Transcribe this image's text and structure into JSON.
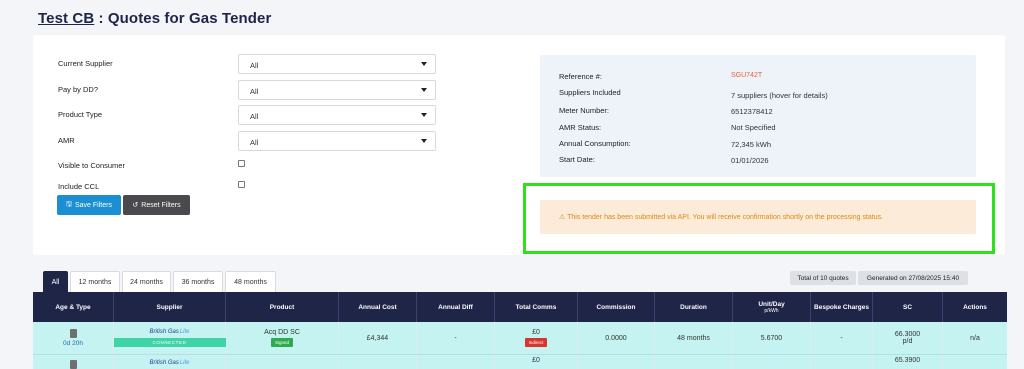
{
  "header": {
    "customer": "Test CB",
    "separator": " : Quotes for ",
    "fuel": "Gas",
    "suffix": " Tender"
  },
  "filters": {
    "current_supplier": {
      "label": "Current Supplier",
      "value": "All"
    },
    "pay_by_dd": {
      "label": "Pay by DD?",
      "value": "All"
    },
    "product_type": {
      "label": "Product Type",
      "value": "All"
    },
    "amr": {
      "label": "AMR",
      "value": "All"
    },
    "visible_to_consumer": {
      "label": "Visible to Consumer"
    },
    "include_ccl": {
      "label": "Include CCL"
    },
    "save_label": "Save Filters",
    "reset_label": "Reset Filters"
  },
  "info": {
    "reference_label": "Reference #:",
    "reference_value": "SGU742T",
    "suppliers_label": "Suppliers Included",
    "suppliers_value": "7 suppliers (hover for details)",
    "meter_label": "Meter Number:",
    "meter_value": "6512378412",
    "amr_label": "AMR Status:",
    "amr_value": "Not Specified",
    "consumption_label": "Annual Consumption:",
    "consumption_value": "72,345 kWh",
    "start_label": "Start Date:",
    "start_value": "01/01/2026"
  },
  "alert": {
    "text": "This tender has been submitted via API. You will receive confirmation shortly on the processing status."
  },
  "tabs": [
    "All",
    "12 months",
    "24 months",
    "36 months",
    "48 months"
  ],
  "summary": {
    "total": "Total of 10 quotes",
    "generated": "Generated on 27/08/2025 15:40"
  },
  "table": {
    "headers": [
      "Age & Type",
      "Supplier",
      "Product",
      "Annual Cost",
      "Annual Diff",
      "Total Comms",
      "Commission",
      "Duration",
      "Unit/Day",
      "Bespoke Charges",
      "SC",
      "Actions"
    ],
    "unit_sub": "p/kWh",
    "rows": [
      {
        "age": "0d 20h",
        "supplier_main": "British Gas",
        "supplier_lite": "Lite",
        "status": "CONNECTED",
        "product": "Acq DD SC",
        "product_badge": "Signed",
        "annual_cost": "£4,344",
        "annual_diff": "-",
        "total_comms": "£0",
        "comms_badge": "Indirect",
        "commission": "0.0000",
        "duration": "48 months",
        "unit_day": "5.6700",
        "bespoke": "-",
        "sc_value": "66.3000",
        "sc_unit": "p/d",
        "actions": "n/a"
      },
      {
        "supplier_main": "British Gas",
        "supplier_lite": "Lite",
        "total_comms": "£0",
        "sc_value": "65.3900"
      }
    ]
  },
  "colors": {
    "navy": "#1f2547",
    "save_blue": "#1b8fd1",
    "highlight_green": "#2fe01c",
    "row_teal": "#c4f3f1",
    "alert_bg": "#fcebd9",
    "alert_text": "#d88a12"
  }
}
